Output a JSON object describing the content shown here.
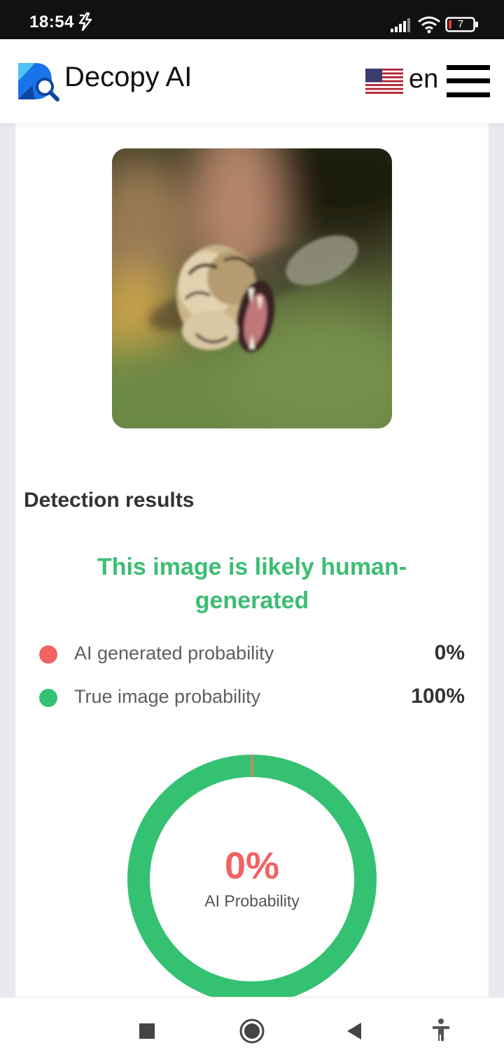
{
  "status_bar": {
    "time": "18:54",
    "battery_level": "7",
    "icons": [
      "charging-bolt-icon",
      "signal-icon",
      "wifi-icon",
      "battery-icon"
    ]
  },
  "header": {
    "brand": "Decopy AI",
    "language": "en",
    "icons": [
      "decopy-logo-icon",
      "us-flag-icon",
      "hamburger-menu-icon"
    ]
  },
  "result": {
    "section_title": "Detection results",
    "verdict": "This image is likely human-generated",
    "rows": [
      {
        "label": "AI generated probability",
        "value": "0%",
        "color": "#f16262"
      },
      {
        "label": "True image probability",
        "value": "100%",
        "color": "#34c172"
      }
    ],
    "donut": {
      "value": "0%",
      "label": "AI Probability",
      "ai_fraction": 0.0,
      "ai_color": "#e27a67",
      "true_color": "#34c172"
    }
  },
  "colors": {
    "accent_green": "#3cbd73",
    "ai_red": "#f16262"
  },
  "nav_bar": {
    "icons": [
      "recent-apps-icon",
      "home-icon",
      "back-icon",
      "accessibility-icon"
    ]
  }
}
